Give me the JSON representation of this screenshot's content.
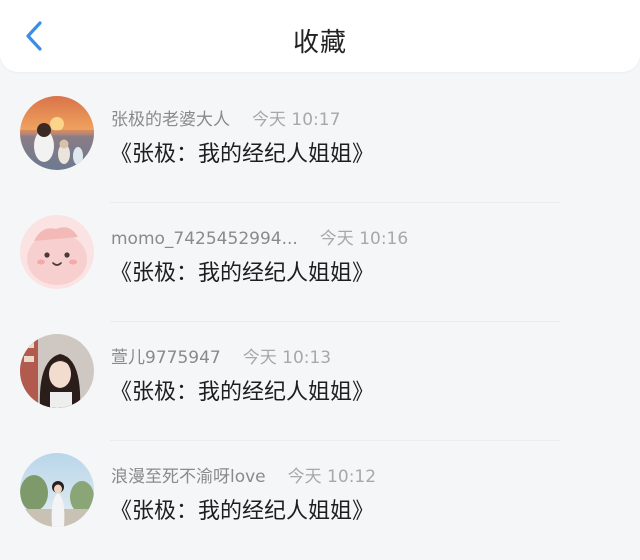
{
  "header": {
    "title": "收藏",
    "back_icon": "chevron-left-icon",
    "accent_color": "#3a8ee6"
  },
  "items": [
    {
      "username": "张极的老婆大人",
      "time": "今天 10:17",
      "title": "《张极：我的经纪人姐姐》"
    },
    {
      "username": "momo_7425452994...",
      "time": "今天 10:16",
      "title": "《张极：我的经纪人姐姐》"
    },
    {
      "username": "萱儿9775947",
      "time": "今天 10:13",
      "title": "《张极：我的经纪人姐姐》"
    },
    {
      "username": "浪漫至死不渝呀love",
      "time": "今天 10:12",
      "title": "《张极：我的经纪人姐姐》"
    }
  ]
}
